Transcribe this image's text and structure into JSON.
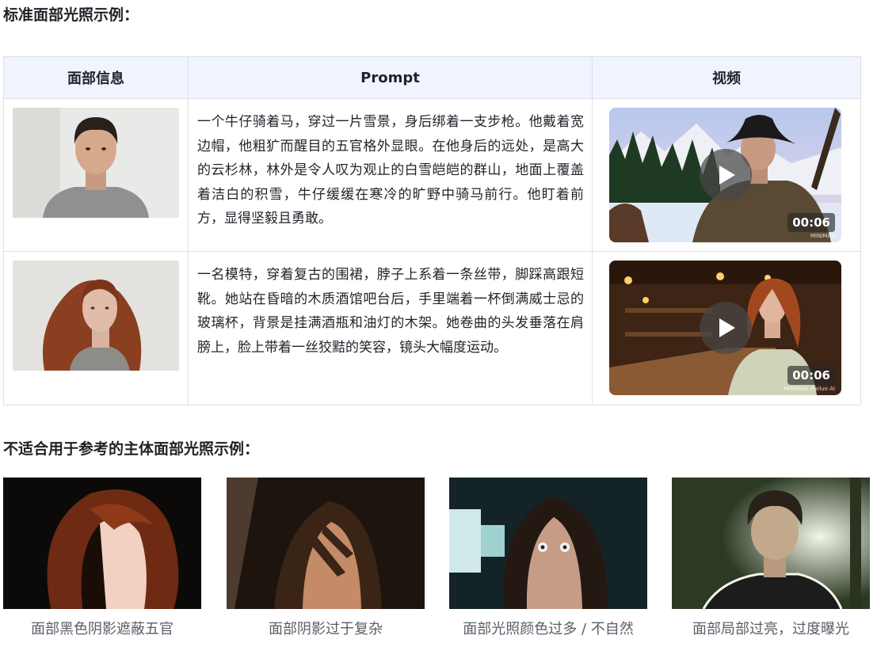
{
  "section_standard": {
    "title": "标准面部光照示例："
  },
  "table": {
    "headers": [
      "面部信息",
      "Prompt",
      "视频"
    ],
    "rows": [
      {
        "prompt": "一个牛仔骑着马，穿过一片雪景，身后绑着一支步枪。他戴着宽边帽，他粗犷而醒目的五官格外显眼。在他身后的远处，是高大的云杉林，林外是令人叹为观止的白雪皑皑的群山，地面上覆盖着洁白的积雪，牛仔缓缓在寒冷的旷野中骑马前行。他盯着前方，显得坚毅且勇敢。",
        "video_duration": "00:06",
        "video_watermark": "MINIMAX"
      },
      {
        "prompt": "一名模特，穿着复古的围裙，脖子上系着一条丝带，脚踩高跟短靴。她站在昏暗的木质酒馆吧台后，手里端着一杯倒满威士忌的玻璃杯，背景是挂满酒瓶和油灯的木架。她卷曲的头发垂落在肩膀上，脸上带着一丝狡黠的笑容，镜头大幅度运动。",
        "video_duration": "00:06",
        "video_watermark": "MINIMAX  Hailuo AI"
      }
    ]
  },
  "section_unsuitable": {
    "title": "不适合用于参考的主体面部光照示例：",
    "examples": [
      {
        "caption": "面部黑色阴影遮蔽五官"
      },
      {
        "caption": "面部阴影过于复杂"
      },
      {
        "caption": "面部光照颜色过多 / 不自然"
      },
      {
        "caption": "面部局部过亮，过度曝光"
      }
    ]
  },
  "colors": {
    "header_bg": "#eff4ff",
    "border": "#dee0e3",
    "text": "#1f2329",
    "caption_text": "#5a5e66"
  }
}
